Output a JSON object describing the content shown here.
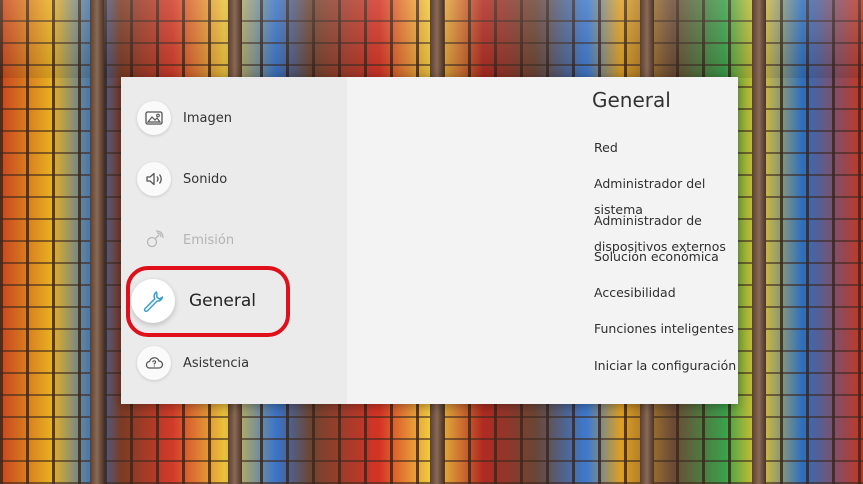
{
  "sidebar": {
    "items": [
      {
        "label": "Imagen",
        "icon": "picture-icon",
        "state": "normal"
      },
      {
        "label": "Sonido",
        "icon": "speaker-icon",
        "state": "normal"
      },
      {
        "label": "Emisión",
        "icon": "broadcast-icon",
        "state": "disabled"
      },
      {
        "label": "General",
        "icon": "wrench-icon",
        "state": "selected"
      },
      {
        "label": "Asistencia",
        "icon": "help-cloud-icon",
        "state": "normal"
      }
    ]
  },
  "content": {
    "title": "General",
    "items": [
      "Red",
      "Administrador del sistema",
      "Administrador de dispositivos externos",
      "Solución económica",
      "Accesibilidad",
      "Funciones inteligentes",
      "Iniciar la configuración"
    ]
  },
  "colors": {
    "highlight": "#e0101b",
    "accent_icon": "#3aa0c8",
    "panel_sidebar": "#ebebeb",
    "panel_content": "#f3f3f3"
  }
}
